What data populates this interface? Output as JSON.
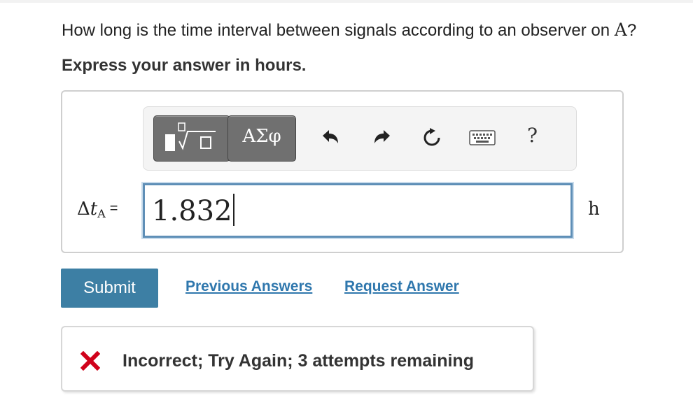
{
  "question": {
    "text": "How long is the time interval between signals according to an observer on ",
    "variable": "A",
    "end": "?"
  },
  "instruction": "Express your answer in hours.",
  "toolbar": {
    "symbols_label": "ΑΣφ",
    "help_label": "?",
    "icons": [
      "templates-icon",
      "undo-icon",
      "redo-icon",
      "reset-icon",
      "keyboard-icon",
      "help-icon"
    ]
  },
  "answer": {
    "delta": "Δ",
    "t": "t",
    "subscript": "A",
    "equals": "=",
    "value": "1.832",
    "unit": "h"
  },
  "actions": {
    "submit": "Submit",
    "previous_answers": "Previous Answers",
    "request_answer": "Request Answer"
  },
  "feedback": {
    "message": "Incorrect; Try Again; 3 attempts remaining",
    "color": "#d0021b"
  },
  "colors": {
    "submit_bg": "#3d7fa4",
    "link": "#2f77ad",
    "input_border": "#5f8fb7"
  }
}
